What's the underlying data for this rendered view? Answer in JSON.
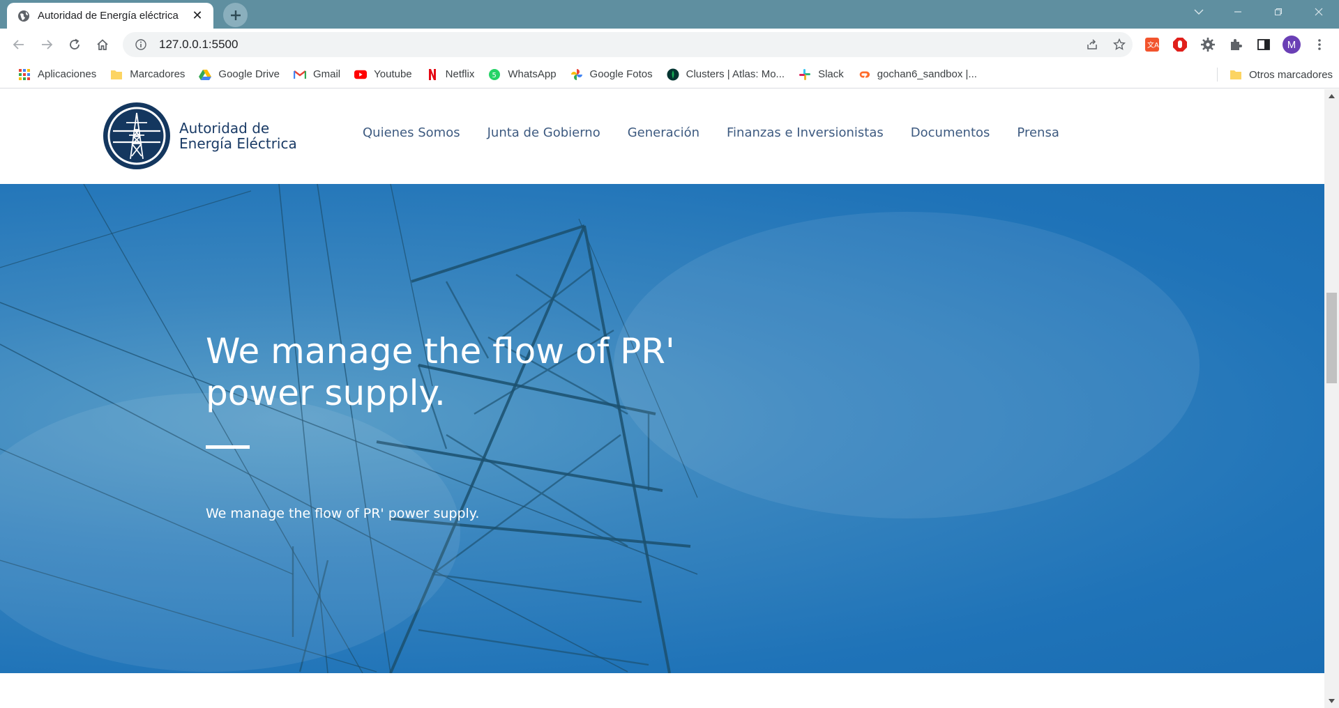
{
  "browser": {
    "tab": {
      "title": "Autoridad de Energía eléctrica",
      "favicon": "globe-icon",
      "close_icon": "close-icon"
    },
    "new_tab_icon": "plus-icon",
    "toolbar": {
      "url": "127.0.0.1:5500",
      "buttons": [
        "back-icon",
        "forward-icon",
        "reload-icon",
        "home-icon"
      ],
      "profile_initial": "M"
    },
    "bookmarks": [
      {
        "label": "Aplicaciones",
        "icon": "apps-grid-icon"
      },
      {
        "label": "Marcadores",
        "icon": "folder-icon"
      },
      {
        "label": "Google Drive",
        "icon": "google-drive-icon"
      },
      {
        "label": "Gmail",
        "icon": "gmail-icon"
      },
      {
        "label": "Youtube",
        "icon": "youtube-icon"
      },
      {
        "label": "Netflix",
        "icon": "netflix-icon"
      },
      {
        "label": "WhatsApp",
        "icon": "whatsapp-icon"
      },
      {
        "label": "Google Fotos",
        "icon": "google-photos-icon"
      },
      {
        "label": "Clusters | Atlas: Mo...",
        "icon": "mongodb-icon"
      },
      {
        "label": "Slack",
        "icon": "slack-icon"
      },
      {
        "label": "gochan6_sandbox |...",
        "icon": "cpanel-icon"
      }
    ],
    "other_bookmarks": "Otros marcadores"
  },
  "site": {
    "logo": {
      "line1": "Autoridad de",
      "line2": "Energía Eléctrica"
    },
    "nav": [
      "Quienes Somos",
      "Junta de Gobierno",
      "Generación",
      "Finanzas e Inversionistas",
      "Documentos",
      "Prensa"
    ],
    "hero": {
      "title": "We manage the flow of PR' power supply.",
      "subtitle": "We manage the flow of PR' power supply."
    }
  },
  "colors": {
    "tabstrip": "#5f8fa0",
    "brand_navy": "#1a3b66",
    "nav_text": "#3d5a80",
    "hero_blue": "#1f73b8"
  }
}
